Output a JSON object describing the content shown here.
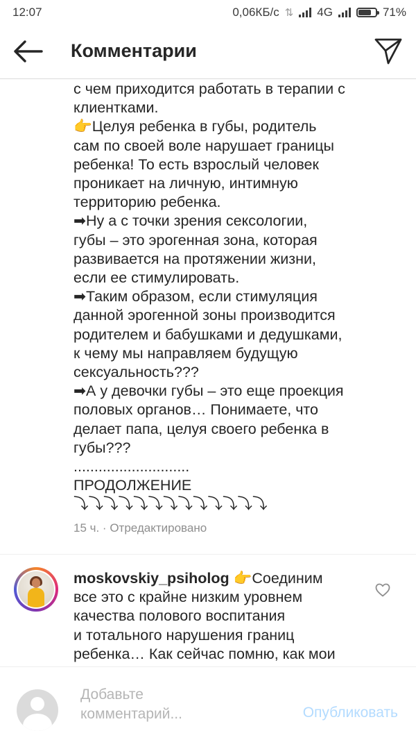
{
  "status_bar": {
    "time": "12:07",
    "network_speed": "0,06КБ/с",
    "network_type": "4G",
    "battery_level": 0.71,
    "battery_text": "71%"
  },
  "header": {
    "title": "Комментарии",
    "back_icon": "arrow-left-icon",
    "send_icon": "direct-send-icon"
  },
  "caption": {
    "lines": [
      "с чем приходится работать в терапии с",
      "клиентками.",
      "👉Целуя ребенка в губы, родитель",
      "сам по своей воле нарушает границы",
      "ребенка! То есть взрослый человек",
      "проникает на личную, интимную",
      "территорию ребенка.",
      "➡Ну а с точки зрения сексологии,",
      "губы – это эрогенная зона, которая",
      "развивается на протяжении жизни,",
      "если ее стимулировать.",
      "➡Таким образом, если стимуляция",
      "данной эрогенной зоны производится",
      "родителем и бабушками и дедушками,",
      "к чему мы направляем будущую",
      "сексуальность???",
      "➡А у девочки губы – это еще проекция",
      "половых органов… Понимаете, что",
      "делает папа, целуя своего ребенка в",
      "губы???",
      "............................",
      "ПРОДОЛЖЕНИЕ",
      "⤵⤵⤵⤵⤵⤵⤵⤵⤵⤵⤵⤵⤵"
    ],
    "meta": "15 ч. · Отредактировано"
  },
  "comment": {
    "username": "moskovskiy_psiholog",
    "first_line_rest": " 👉Соединим",
    "lines": [
      "все это с крайне низким уровнем",
      "качества полового воспитания",
      "и тотального нарушения границ",
      "ребенка… Как сейчас помню, как мои"
    ],
    "heart_icon": "heart-outline-icon"
  },
  "footer": {
    "input_placeholder": "Добавьте\nкомментарий...",
    "publish_label": "Опубликовать",
    "publish_color": "#b3dbff"
  }
}
